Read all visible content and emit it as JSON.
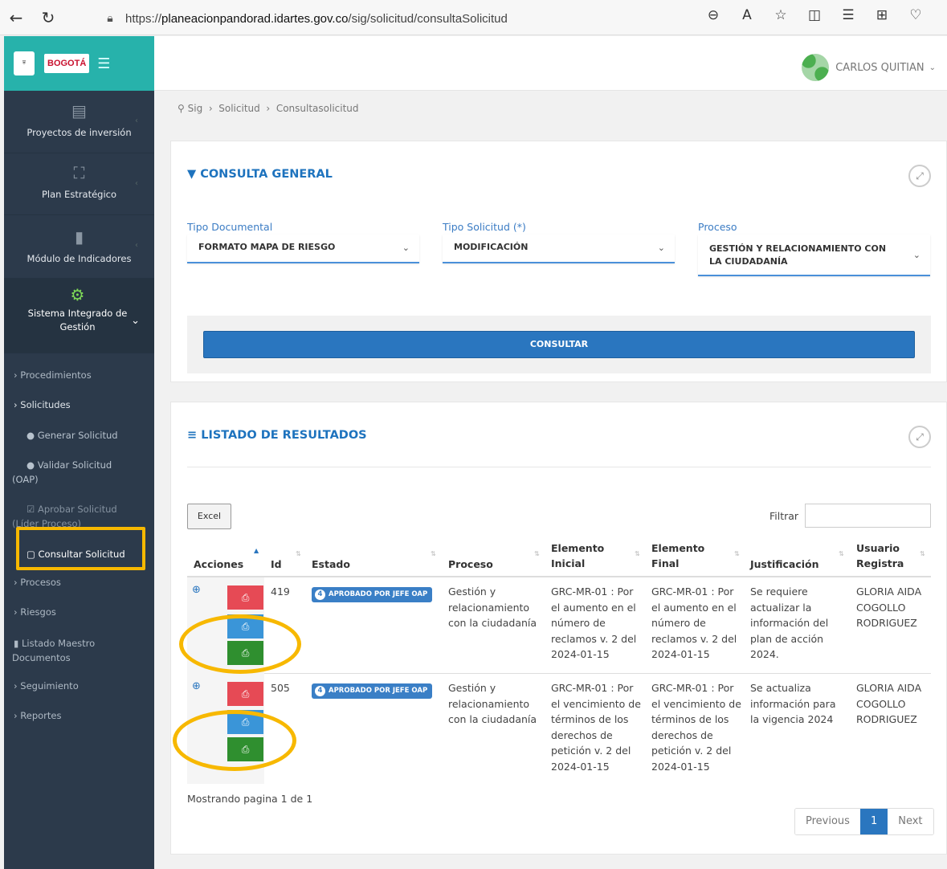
{
  "browser": {
    "url_prefix": "https://",
    "url_host": "planeacionpandorad.idartes.gov.co",
    "url_path": "/sig/solicitud/consultaSolicitud",
    "icons": [
      "back-icon",
      "reload-icon",
      "zoom-out-icon",
      "read-aloud-icon",
      "favorite-icon",
      "split-screen-icon",
      "favorites-bar-icon",
      "collections-icon",
      "browser-essentials-icon"
    ]
  },
  "logo": {
    "shield": "ALCALDÍA MAYOR DE BOGOTÁ D.C.",
    "bogota": "BOGOTÁ"
  },
  "user": {
    "name": "CARLOS QUITIAN"
  },
  "sidebar": {
    "main": [
      {
        "label": "Proyectos de inversión",
        "icon": "database-icon"
      },
      {
        "label": "Plan Estratégico",
        "icon": "binoculars-icon"
      },
      {
        "label": "Módulo de Indicadores",
        "icon": "bar-chart-icon"
      },
      {
        "label": "Sistema Integrado de Gestión",
        "icon": "gears-icon"
      }
    ],
    "sub": [
      "Procedimientos",
      "Solicitudes",
      "Procesos",
      "Riesgos",
      "Listado Maestro Documentos",
      "Seguimiento",
      "Reportes"
    ],
    "solicitudes_children": [
      "Generar Solicitud",
      "Validar Solicitud (OAP)",
      "Aprobar Solicitud (Líder Proceso)",
      "Consultar Solicitud"
    ]
  },
  "breadcrumb": [
    "Sig",
    "Solicitud",
    "Consultasolicitud"
  ],
  "consulta": {
    "title": "CONSULTA GENERAL",
    "tipo_documental_label": "Tipo Documental",
    "tipo_documental_value": "FORMATO MAPA DE RIESGO",
    "tipo_solicitud_label": "Tipo Solicitud (*)",
    "tipo_solicitud_value": "MODIFICACIÓN",
    "proceso_label": "Proceso",
    "proceso_value": "GESTIÓN Y RELACIONAMIENTO CON LA CIUDADANÍA",
    "button": "CONSULTAR"
  },
  "resultados": {
    "title": "LISTADO DE RESULTADOS",
    "excel": "Excel",
    "filtrar": "Filtrar",
    "columns": [
      "Acciones",
      "Id",
      "Estado",
      "Proceso",
      "Elemento Inicial",
      "Elemento Final",
      "Justificación",
      "Usuario Registra"
    ],
    "rows": [
      {
        "id": "419",
        "estado_num": "4",
        "estado": "APROBADO POR JEFE OAP",
        "proceso": "Gestión y relacionamiento con la ciudadanía",
        "inicial": "GRC-MR-01 : Por el aumento en el número de reclamos v. 2 del 2024-01-15",
        "final": "GRC-MR-01 : Por el aumento en el número de reclamos v. 2 del 2024-01-15",
        "justificacion": "Se requiere actualizar la información del plan de acción 2024.",
        "usuario": "GLORIA AIDA COGOLLO RODRIGUEZ"
      },
      {
        "id": "505",
        "estado_num": "4",
        "estado": "APROBADO POR JEFE OAP",
        "proceso": "Gestión y relacionamiento con la ciudadanía",
        "inicial": "GRC-MR-01 : Por el vencimiento de términos de los derechos de petición v. 2 del 2024-01-15",
        "final": "GRC-MR-01 : Por el vencimiento de términos de los derechos de petición v. 2 del 2024-01-15",
        "justificacion": "Se actualiza información para la vigencia 2024",
        "usuario": "GLORIA AIDA COGOLLO RODRIGUEZ"
      }
    ],
    "info": "Mostrando pagina 1 de 1",
    "pager": {
      "prev": "Previous",
      "page": "1",
      "next": "Next"
    }
  },
  "colors": {
    "sidebar": "#2c3a4b",
    "logo_bg": "#27b2ab",
    "primary": "#2a76bf",
    "highlight": "#f7b800",
    "pdf_red": "#e64a55",
    "pdf_blue": "#3a95d8",
    "pdf_green": "#2f8f2f"
  }
}
